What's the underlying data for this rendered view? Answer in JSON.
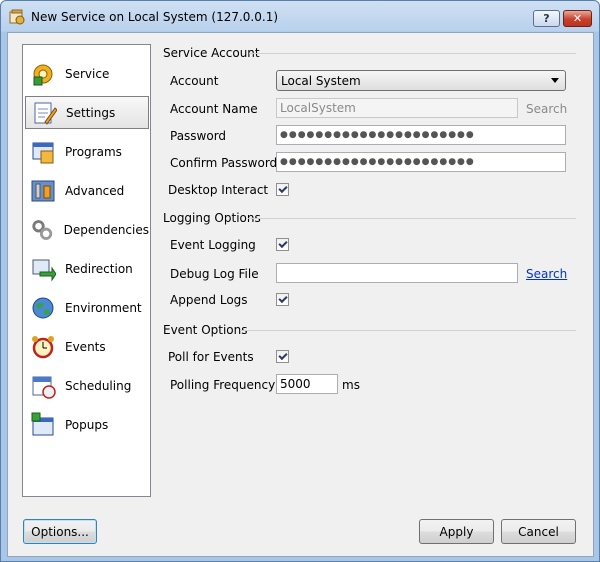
{
  "window": {
    "title": "New Service on Local System (127.0.0.1)",
    "help_label": "?",
    "close_label": "✕"
  },
  "sidebar": {
    "items": [
      {
        "label": "Service",
        "icon": "service-gear-icon"
      },
      {
        "label": "Settings",
        "icon": "settings-notepad-icon",
        "selected": true
      },
      {
        "label": "Programs",
        "icon": "programs-window-icon"
      },
      {
        "label": "Advanced",
        "icon": "advanced-tools-icon"
      },
      {
        "label": "Dependencies",
        "icon": "dependencies-chain-icon"
      },
      {
        "label": "Redirection",
        "icon": "redirection-arrow-icon"
      },
      {
        "label": "Environment",
        "icon": "environment-globe-icon"
      },
      {
        "label": "Events",
        "icon": "events-alarm-clock-icon"
      },
      {
        "label": "Scheduling",
        "icon": "scheduling-calendar-icon"
      },
      {
        "label": "Popups",
        "icon": "popups-window-icon"
      }
    ]
  },
  "service_account": {
    "title": "Service Account",
    "account_label": "Account",
    "account_value": "Local System",
    "account_name_label": "Account  Name",
    "account_name_value": "LocalSystem",
    "account_search": "Search",
    "password_label": "Password",
    "password_value": "●●●●●●●●●●●●●●●●●●●●●●",
    "confirm_label": "Confirm Password",
    "confirm_value": "●●●●●●●●●●●●●●●●●●●●●●",
    "desktop_interact_label": "Desktop Interact",
    "desktop_interact_checked": true
  },
  "logging_options": {
    "title": "Logging Options",
    "event_logging_label": "Event Logging",
    "event_logging_checked": true,
    "debug_log_label": "Debug Log File",
    "debug_log_value": "",
    "debug_search": "Search",
    "append_logs_label": "Append Logs",
    "append_logs_checked": true
  },
  "event_options": {
    "title": "Event Options",
    "poll_label": "Poll for Events",
    "poll_checked": true,
    "frequency_label": "Polling Frequency",
    "frequency_value": "5000",
    "frequency_unit": "ms"
  },
  "buttons": {
    "options": "Options...",
    "apply": "Apply",
    "cancel": "Cancel"
  },
  "colors": {
    "titlebar": "#b9d1ec",
    "client": "#f0f0f0",
    "link": "#0033cc",
    "close": "#c7432e"
  }
}
